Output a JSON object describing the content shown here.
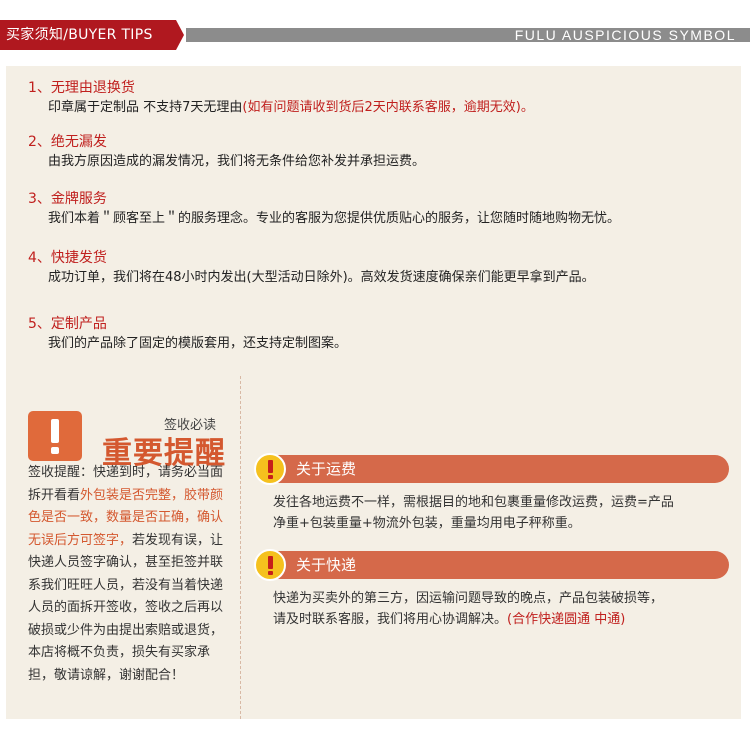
{
  "header": {
    "title": "买家须知/BUYER TIPS",
    "symbol": "FULU AUSPICIOUS SYMBOL"
  },
  "items": [
    {
      "head": "1、无理由退换货",
      "body": "印章属于定制品   不支持7天无理由",
      "body_red": "(如有问题请收到货后2天内联系客服，逾期无效)。"
    },
    {
      "head": "2、绝无漏发",
      "body": "由我方原因造成的漏发情况，我们将无条件给您补发并承担运费。",
      "body_red": ""
    },
    {
      "head": "3、金牌服务",
      "body": "我们本着＂顾客至上＂的服务理念。专业的客服为您提供优质贴心的服务，让您随时随地购物无忧。",
      "body_red": ""
    },
    {
      "head": "4、快捷发货",
      "body": "成功订单，我们将在48小时内发出(大型活动日除外)。高效发货速度确保亲们能更早拿到产品。",
      "body_red": ""
    },
    {
      "head": "5、定制产品",
      "body": "我们的产品除了固定的模版套用，还支持定制图案。",
      "body_red": ""
    }
  ],
  "remind": {
    "sign": "签收必读",
    "title": "重要提醒",
    "text_1": "签收提醒：快递到时，请务必当面拆开看看",
    "text_red": "外包装是否完整，胶带颜色是否一致，数量是否正确，确认无误后方可签字，",
    "text_2": "若发现有误，让快递人员签字确认，甚至拒签并联系我们旺旺人员，若没有当着快递人员的面拆开签收，签收之后再以破损或少件为由提出索赔或退货，本店将概不负责，损失有买家承担，敬请谅解，谢谢配合！"
  },
  "shipping": {
    "title": "关于运费",
    "line1": "发往各地运费不一样，需根据目的地和包裹重量修改运费，运费=产品",
    "line2": "净重+包装重量+物流外包装，重量均用电子秤称重。"
  },
  "courier": {
    "title": "关于快递",
    "line1": "快递为买卖外的第三方，因运输问题导致的晚点，产品包装破损等，",
    "line2": "请及时联系客服，我们将用心协调解决。",
    "line2_red": "(合作快递圆通 中通)"
  },
  "colors": {
    "header_red": "#b0181f",
    "header_gray": "#8c8c8c",
    "panel_bg": "#f4efe5",
    "accent_red": "#c0201e",
    "orange": "#d5694a",
    "warning_yellow": "#f5c11e"
  }
}
